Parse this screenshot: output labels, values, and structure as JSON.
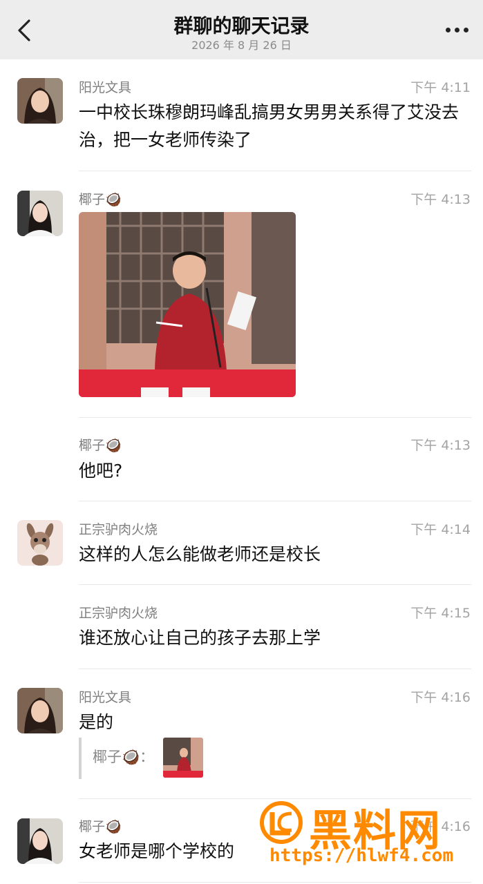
{
  "header": {
    "title": "群聊的聊天记录",
    "date": "2026 年 8 月 26 日"
  },
  "messages": [
    {
      "sender": "阳光文具",
      "time": "下午 4:11",
      "text": "一中校长珠穆朗玛峰乱搞男女男男关系得了艾没去治，把一女老师传染了",
      "avatar": "woman-portrait-1"
    },
    {
      "sender": "椰子🥥",
      "time": "下午 4:13",
      "type": "image",
      "image": "man-speaking-at-podium-photo",
      "avatar": "woman-portrait-2"
    },
    {
      "sender": "椰子🥥",
      "time": "下午 4:13",
      "text": "他吧?"
    },
    {
      "sender": "正宗驴肉火烧",
      "time": "下午 4:14",
      "text": "这样的人怎么能做老师还是校长",
      "avatar": "donkey-cartoon"
    },
    {
      "sender": "正宗驴肉火烧",
      "time": "下午 4:15",
      "text": "谁还放心让自己的孩子去那上学"
    },
    {
      "sender": "阳光文具",
      "time": "下午 4:16",
      "text": "是的",
      "quote": {
        "name": "椰子🥥：",
        "image": "man-speaking-thumbnail"
      },
      "avatar": "woman-portrait-1"
    },
    {
      "sender": "椰子🥥",
      "time": "下午 4:16",
      "text": "女老师是哪个学校的",
      "avatar": "woman-portrait-2"
    }
  ],
  "watermark": {
    "text": "黑料网",
    "url": "https://hlwf4.com",
    "color": "#ff8a00"
  }
}
